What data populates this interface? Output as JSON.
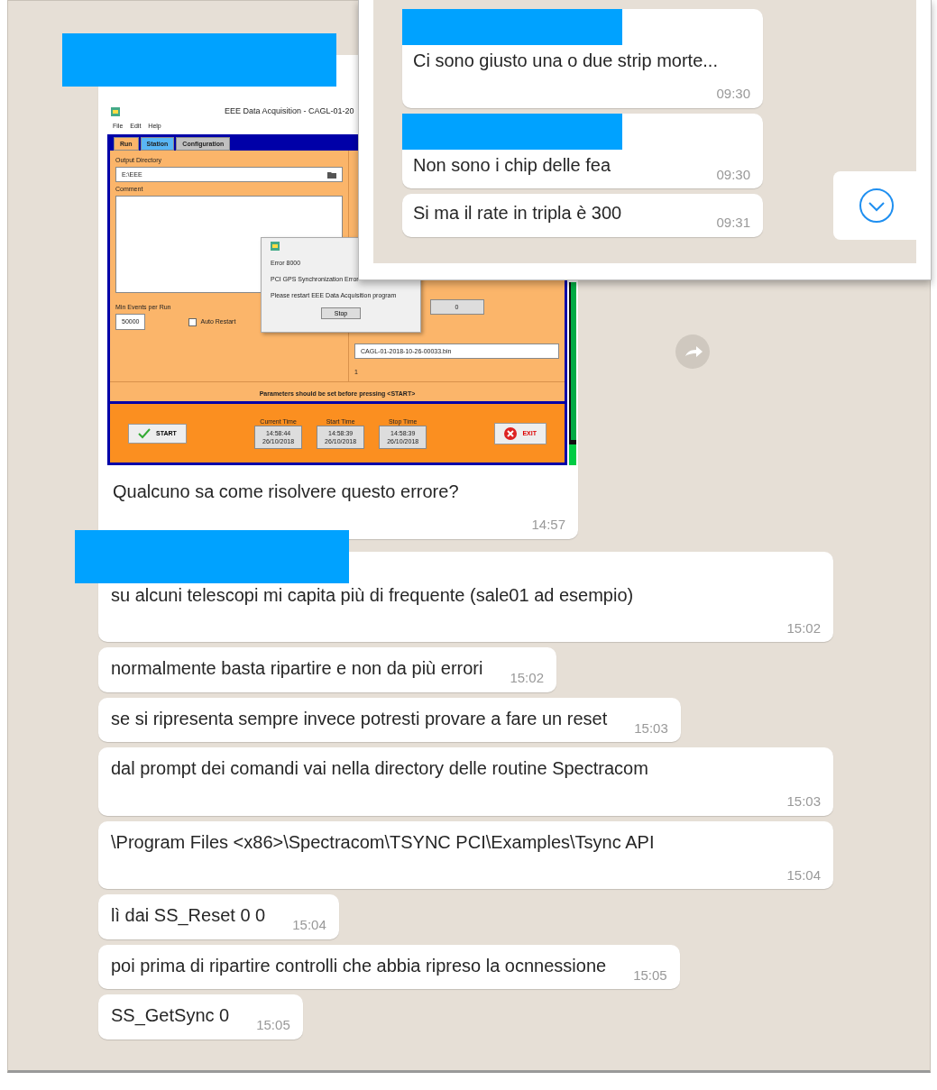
{
  "inset": {
    "messages": [
      {
        "redacted_sender": true,
        "text": "Ci sono giusto una o due strip morte...",
        "time": "09:30"
      },
      {
        "redacted_sender": true,
        "text": "Non sono i chip delle fea",
        "time": "09:30"
      },
      {
        "redacted_sender": false,
        "text": "Si ma il rate in tripla è 300",
        "time": "09:31"
      }
    ]
  },
  "messages": [
    {
      "kind": "image",
      "redacted_sender": true,
      "time_below": true,
      "text": "Qualcuno sa come risolvere questo errore?",
      "time": "14:57",
      "screenshot": {
        "title": "EEE Data Acquisition - CAGL-01-20",
        "menu": [
          "File",
          "Edit",
          "Help"
        ],
        "tabs": [
          {
            "label": "Run",
            "selected": true
          },
          {
            "label": "Station",
            "selected": false
          },
          {
            "label": "Configuration",
            "selected": false
          }
        ],
        "output_directory_label": "Output Directory",
        "output_directory": "E:\\EEE",
        "comment_label": "Comment",
        "min_events_label": "Min Events per Run",
        "min_events": "50000",
        "auto_restart": {
          "label": "Auto Restart",
          "checked": false
        },
        "counter": "0",
        "file": "CAGL-01-2018-10-26-00033.bin",
        "file_index": "1",
        "hint": "Parameters should be set before pressing <START>",
        "start": "START",
        "exit": "EXIT",
        "times": [
          {
            "label": "Current Time",
            "time": "14:58:44",
            "date": "26/10/2018"
          },
          {
            "label": "Start Time",
            "time": "14:58:39",
            "date": "26/10/2018"
          },
          {
            "label": "Stop Time",
            "time": "14:58:39",
            "date": "26/10/2018"
          }
        ],
        "dialog": {
          "lines": [
            "Error 8000",
            "PCI GPS Synchronization Error",
            "Please restart EEE Data Acquisition program"
          ],
          "button": "Stop"
        }
      }
    },
    {
      "kind": "text",
      "redacted_sender": true,
      "time_below": true,
      "text": "su alcuni telescopi mi capita più di frequente (sale01 ad esempio)",
      "time": "15:02"
    },
    {
      "kind": "text",
      "redacted_sender": false,
      "time_below": false,
      "text": "normalmente basta ripartire e non da più errori",
      "time": "15:02"
    },
    {
      "kind": "text",
      "redacted_sender": false,
      "time_below": false,
      "text": "se si ripresenta sempre invece potresti provare a fare un reset",
      "time": "15:03"
    },
    {
      "kind": "text",
      "redacted_sender": false,
      "time_below": true,
      "text": "dal prompt dei comandi vai nella directory delle routine Spectracom",
      "time": "15:03"
    },
    {
      "kind": "text",
      "redacted_sender": false,
      "time_below": true,
      "text": "\\Program Files <x86>\\Spectracom\\TSYNC PCI\\Examples\\Tsync API",
      "time": "15:04"
    },
    {
      "kind": "text",
      "redacted_sender": false,
      "time_below": false,
      "text": "lì dai SS_Reset 0 0",
      "time": "15:04"
    },
    {
      "kind": "text",
      "redacted_sender": false,
      "time_below": false,
      "text": "poi prima di ripartire controlli che abbia ripreso la ocnnessione",
      "time": "15:05"
    },
    {
      "kind": "text",
      "redacted_sender": false,
      "time_below": false,
      "text": "SS_GetSync 0",
      "time": "15:05"
    }
  ]
}
